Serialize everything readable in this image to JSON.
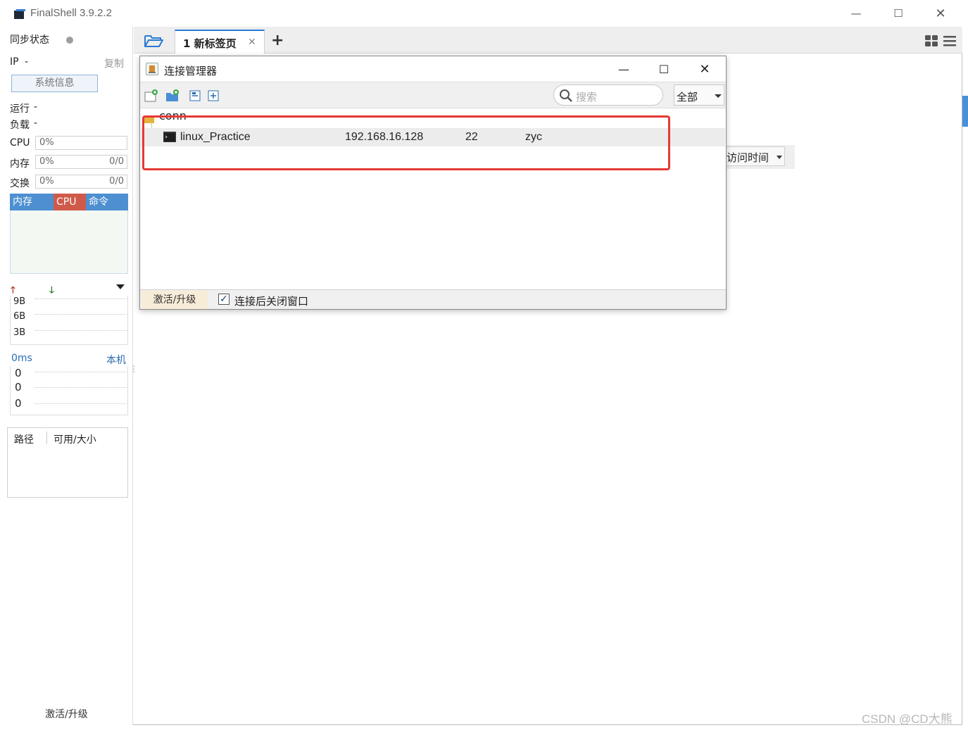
{
  "window": {
    "title": "FinalShell 3.9.2.2"
  },
  "sidebar": {
    "sync_label": "同步状态",
    "ip_label": "IP",
    "ip_value": "-",
    "copy_label": "复制",
    "sysinfo_button": "系统信息",
    "run_label": "运行",
    "run_value": "-",
    "load_label": "负载",
    "load_value": "-",
    "cpu": {
      "label": "CPU",
      "value": "0%"
    },
    "mem": {
      "label": "内存",
      "value": "0%",
      "ratio": "0/0"
    },
    "swap": {
      "label": "交换",
      "value": "0%",
      "ratio": "0/0"
    },
    "proc_tabs": [
      "内存",
      "CPU",
      "命令"
    ],
    "net_labels": [
      "9B",
      "6B",
      "3B"
    ],
    "ping_value": "0ms",
    "ping_target": "本机",
    "ping_rows": [
      "0",
      "0",
      "0"
    ],
    "disk_headers": [
      "路径",
      "可用/大小"
    ],
    "activate_label": "激活/升级"
  },
  "tabbar": {
    "tabs": [
      {
        "label": "1 新标签页"
      }
    ]
  },
  "background": {
    "sort_label": "访问时间"
  },
  "dialog": {
    "title": "连接管理器",
    "search_placeholder": "搜索",
    "filter_value": "全部",
    "folder_name": "conn",
    "connections": [
      {
        "name": "linux_Practice",
        "host": "192.168.16.128",
        "port": "22",
        "user": "zyc"
      }
    ],
    "activate_label": "激活/升级",
    "close_after_connect": "连接后关闭窗口",
    "close_after_connect_checked": true
  },
  "watermark": "CSDN @CD大熊",
  "colors": {
    "accent": "#4a90d9",
    "cpu_tab": "#d9534f",
    "highlight_box": "#e53935"
  }
}
